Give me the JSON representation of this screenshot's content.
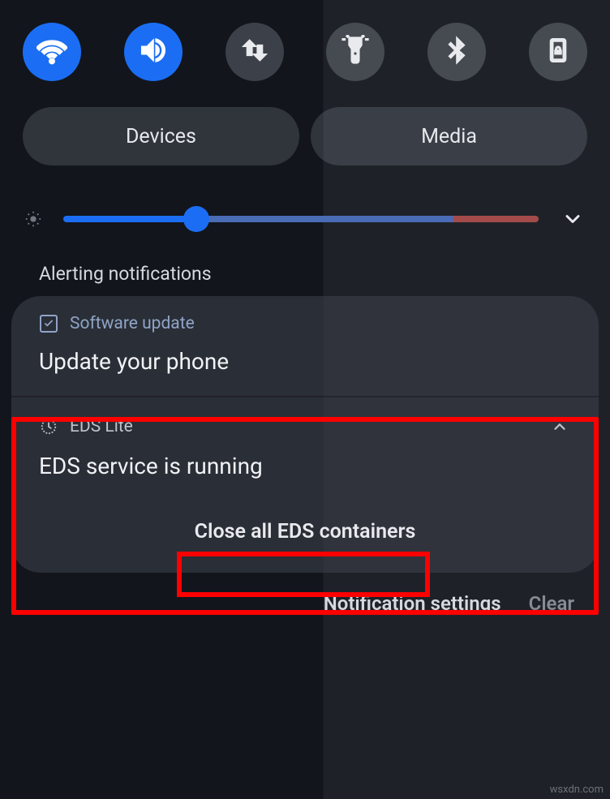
{
  "quick_settings": {
    "tiles": [
      {
        "name": "wifi",
        "active": true
      },
      {
        "name": "sound",
        "active": true
      },
      {
        "name": "data-transfer",
        "active": false
      },
      {
        "name": "flashlight",
        "active": false
      },
      {
        "name": "bluetooth",
        "active": false
      },
      {
        "name": "rotation-lock",
        "active": false
      }
    ],
    "pills": {
      "devices": "Devices",
      "media": "Media"
    },
    "brightness_percent": 28
  },
  "section_label": "Alerting notifications",
  "notifications": [
    {
      "app": "Software update",
      "icon": "checkbox",
      "title": "Update your phone",
      "expanded": false
    },
    {
      "app": "EDS Lite",
      "icon": "clock",
      "title": "EDS service is running",
      "expanded": true,
      "action": "Close all EDS containers"
    }
  ],
  "footer": {
    "settings": "Notification settings",
    "clear": "Clear"
  },
  "watermark": "wsxdn.com"
}
